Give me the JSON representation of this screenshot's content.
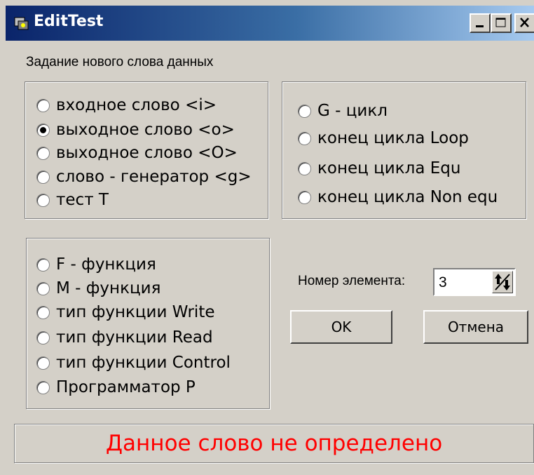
{
  "window": {
    "title": "EditTest"
  },
  "header": {
    "caption": "Задание нового слова данных"
  },
  "group_words": {
    "items": [
      {
        "label": "входное слово <i>",
        "checked": false
      },
      {
        "label": "выходное слово <o>",
        "checked": true
      },
      {
        "label": "выходное слово <O>",
        "checked": false
      },
      {
        "label": "слово - генератор <g>",
        "checked": false
      },
      {
        "label": "тест T",
        "checked": false
      }
    ]
  },
  "group_cycles": {
    "items": [
      {
        "label": "G - цикл",
        "checked": false
      },
      {
        "label": "конец цикла Loop",
        "checked": false
      },
      {
        "label": "конец цикла Equ",
        "checked": false
      },
      {
        "label": "конец цикла Non equ",
        "checked": false
      }
    ]
  },
  "group_functions": {
    "items": [
      {
        "label": "F - функция",
        "checked": false
      },
      {
        "label": "M - функция",
        "checked": false
      },
      {
        "label": "тип функции Write",
        "checked": false
      },
      {
        "label": "тип функции Read",
        "checked": false
      },
      {
        "label": "тип функции Control",
        "checked": false
      },
      {
        "label": "Программатор P",
        "checked": false
      }
    ]
  },
  "element_number": {
    "label": "Номер элемента:",
    "value": "3"
  },
  "buttons": {
    "ok": "OK",
    "cancel": "Отмена"
  },
  "status": {
    "text": "Данное слово не определено",
    "color": "#ff0000"
  }
}
